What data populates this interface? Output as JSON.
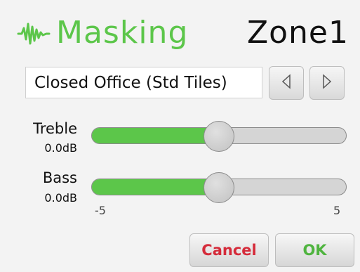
{
  "header": {
    "title": "Masking",
    "zone": "Zone1",
    "icon": "waveform-icon"
  },
  "preset": {
    "value": "Closed Office (Std Tiles)",
    "prev_icon": "triangle-left-icon",
    "next_icon": "triangle-right-icon"
  },
  "sliders": {
    "treble": {
      "label": "Treble",
      "value_text": "0.0dB",
      "value": 0
    },
    "bass": {
      "label": "Bass",
      "value_text": "0.0dB",
      "value": 0
    },
    "min_label": "-5",
    "max_label": "5"
  },
  "actions": {
    "cancel_label": "Cancel",
    "ok_label": "OK"
  },
  "colors": {
    "accent": "#5cc64a",
    "cancel": "#d52b3a",
    "ok": "#4fb43f",
    "track": "#d5d5d5",
    "background": "#f3f3f3"
  }
}
